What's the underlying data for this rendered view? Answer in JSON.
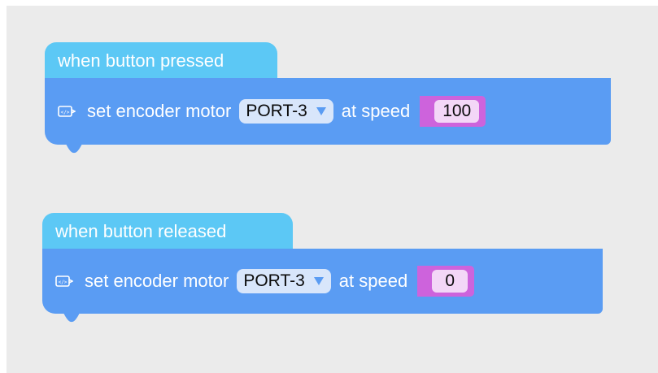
{
  "colors": {
    "workspace_bg": "#ebebeb",
    "hat_block": "#5cc8f5",
    "motion_block": "#5a9cf3",
    "dropdown_bg": "#d8e6fb",
    "reporter": "#cd63dc",
    "value_bg": "#f3d7f7"
  },
  "scripts": [
    {
      "hat_label": "when button pressed",
      "block": {
        "icon": "code-icon",
        "text_before": "set encoder motor",
        "port_value": "PORT-3",
        "dropdown_icon": "triangle-down-icon",
        "text_after": "at speed",
        "speed_value": "100"
      }
    },
    {
      "hat_label": "when button released",
      "block": {
        "icon": "code-icon",
        "text_before": "set encoder motor",
        "port_value": "PORT-3",
        "dropdown_icon": "triangle-down-icon",
        "text_after": "at speed",
        "speed_value": "0"
      }
    }
  ]
}
